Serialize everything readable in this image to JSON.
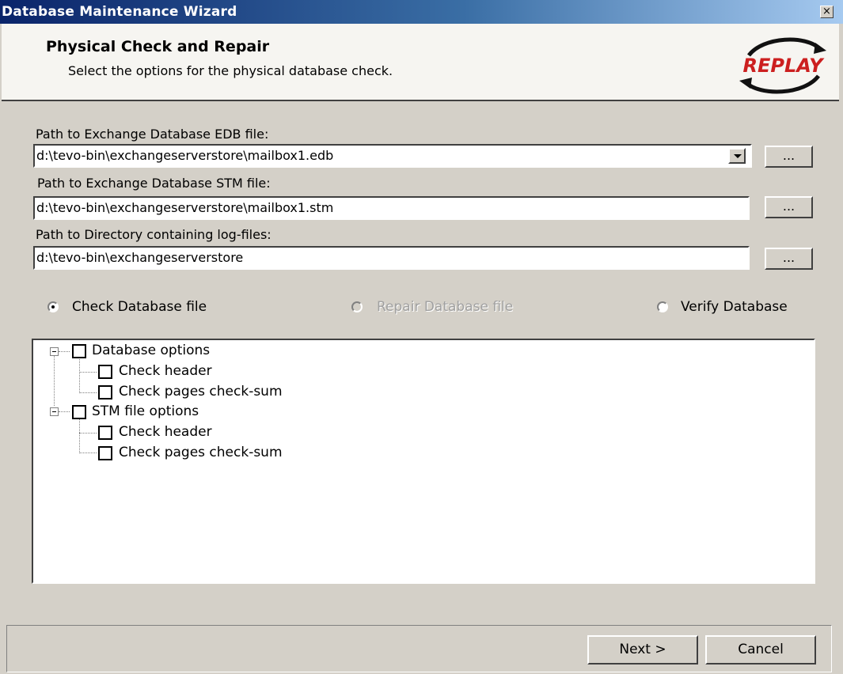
{
  "window": {
    "title": "Database Maintenance Wizard",
    "close_glyph": "×"
  },
  "header": {
    "title": "Physical Check and Repair",
    "subtitle": "Select the options for the physical database check.",
    "logo_text": "REPLAY",
    "logo_color": "#cc1f1f"
  },
  "form": {
    "edb": {
      "label": "Path to Exchange Database EDB file:",
      "value": "d:\\tevo-bin\\exchangeserverstore\\mailbox1.edb",
      "browse_label": "..."
    },
    "stm": {
      "label": "Path to Exchange Database STM file:",
      "value": "d:\\tevo-bin\\exchangeserverstore\\mailbox1.stm",
      "browse_label": "..."
    },
    "logs": {
      "label": "Path to Directory containing log-files:",
      "value": "d:\\tevo-bin\\exchangeserverstore",
      "browse_label": "..."
    }
  },
  "mode": {
    "check": "Check Database file",
    "repair": "Repair Database file",
    "verify": "Verify Database",
    "selected": "check"
  },
  "tree": {
    "database_group": "Database options",
    "db_check_header": "Check header",
    "db_check_pages": "Check pages check-sum",
    "stm_group": "STM file options",
    "stm_check_header": "Check header",
    "stm_check_pages": "Check pages check-sum"
  },
  "buttons": {
    "next": "Next >",
    "cancel": "Cancel"
  }
}
